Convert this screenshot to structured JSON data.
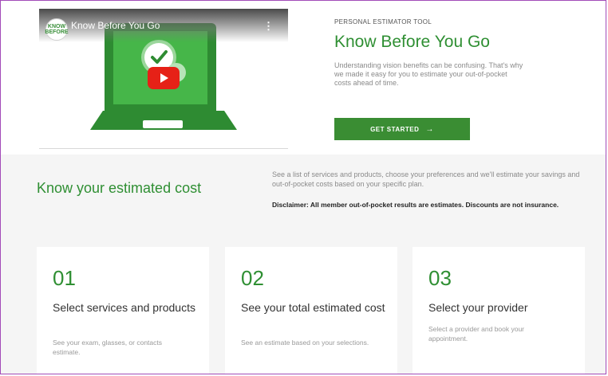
{
  "video": {
    "channel_logo_text": "KNOW BEFORE",
    "title": "Know Before You Go",
    "menu_icon": "kebab-icon",
    "play_icon": "youtube-play-icon"
  },
  "hero": {
    "eyebrow": "PERSONAL ESTIMATOR TOOL",
    "title": "Know Before You Go",
    "description": "Understanding vision benefits can be confusing. That's why we made it easy for you to estimate your out-of-pocket costs ahead of time.",
    "cta_label": "GET STARTED",
    "cta_arrow": "→"
  },
  "estimate": {
    "title": "Know your estimated cost",
    "description": "See a list of services and products, choose your preferences and we'll estimate your savings and out-of-pocket costs based on your specific plan.",
    "disclaimer": "Disclaimer: All member out-of-pocket results are estimates. Discounts are not insurance."
  },
  "steps": [
    {
      "number": "01",
      "title": "Select services and products",
      "description": "See your exam, glasses, or contacts estimate."
    },
    {
      "number": "02",
      "title": "See your total estimated cost",
      "description": "See an estimate based on your selections."
    },
    {
      "number": "03",
      "title": "Select your provider",
      "description": "Select a provider and book your appointment."
    }
  ],
  "colors": {
    "brand_green": "#2f8f33",
    "button_green": "#3a8d33",
    "frame_border": "#a24bb8",
    "youtube_red": "#e62117"
  }
}
